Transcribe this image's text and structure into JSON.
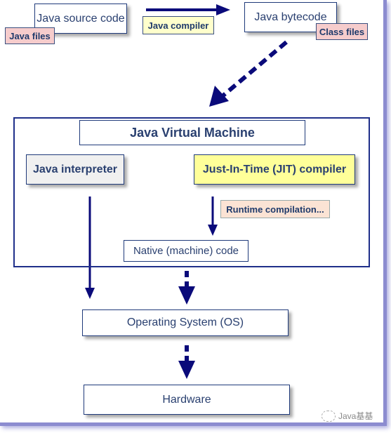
{
  "source": {
    "label": "Java source code",
    "tag": "Java files"
  },
  "compiler": {
    "label": "Java compiler"
  },
  "bytecode": {
    "label": "Java bytecode",
    "tag": "Class files"
  },
  "jvm": {
    "title": "Java Virtual Machine",
    "interpreter": "Java interpreter",
    "jit": "Just-In-Time (JIT) compiler",
    "runtime": "Runtime compilation...",
    "native": "Native (machine) code"
  },
  "os": {
    "label": "Operating System (OS)"
  },
  "hardware": {
    "label": "Hardware"
  },
  "watermark": "Java基基",
  "colors": {
    "arrow": "#0a0a7a",
    "tag_pink": "#f6cccc",
    "tag_yellow": "#ffffcc",
    "jit_box": "#ffff99",
    "interpreter_box": "#f0f0f0"
  }
}
